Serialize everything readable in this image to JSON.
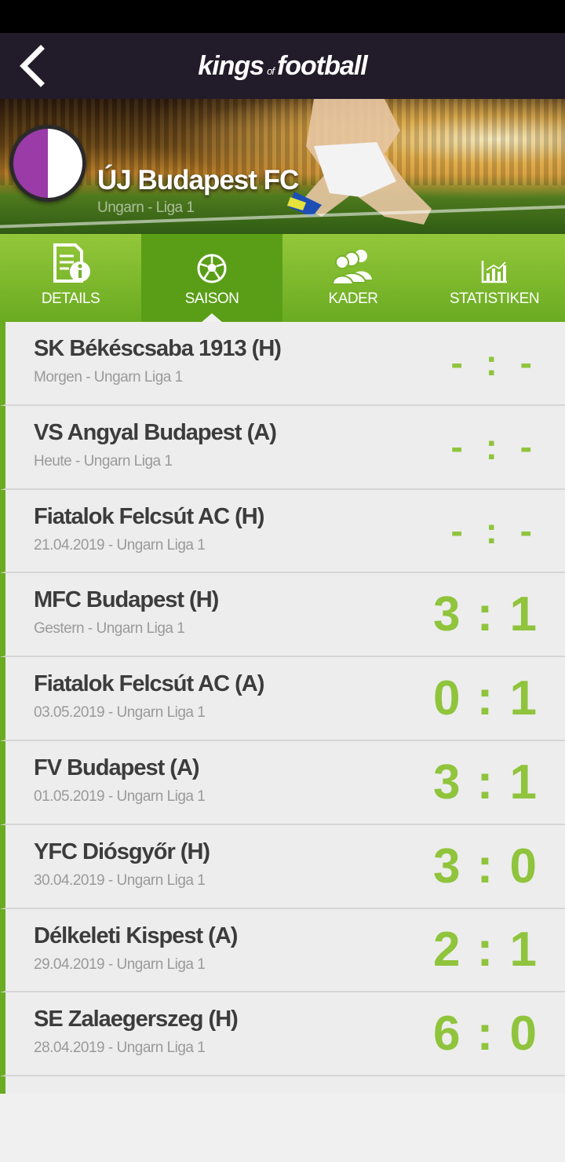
{
  "header": {
    "logo_kings": "kings",
    "logo_of": "of",
    "logo_football": "football"
  },
  "team": {
    "name": "ÚJ Budapest FC",
    "league": "Ungarn - Liga 1",
    "crest_colors": [
      "#9a3ba8",
      "#ffffff"
    ]
  },
  "tabs": [
    {
      "label": "DETAILS",
      "icon": "document-info-icon",
      "active": false
    },
    {
      "label": "SAISON",
      "icon": "soccer-ball-icon",
      "active": true
    },
    {
      "label": "KADER",
      "icon": "people-group-icon",
      "active": false
    },
    {
      "label": "STATISTIKEN",
      "icon": "bar-chart-icon",
      "active": false
    }
  ],
  "matches": [
    {
      "title": "SK Békéscsaba 1913 (H)",
      "sub": "Morgen - Ungarn Liga 1",
      "score": "- : -"
    },
    {
      "title": "VS Angyal Budapest (A)",
      "sub": "Heute - Ungarn Liga 1",
      "score": "- : -"
    },
    {
      "title": "Fiatalok Felcsút AC (H)",
      "sub": "21.04.2019 - Ungarn Liga 1",
      "score": "- : -"
    },
    {
      "title": "MFC Budapest (H)",
      "sub": "Gestern - Ungarn Liga 1",
      "score": "3 : 1"
    },
    {
      "title": "Fiatalok Felcsút AC (A)",
      "sub": "03.05.2019 - Ungarn Liga 1",
      "score": "0 : 1"
    },
    {
      "title": "FV Budapest (A)",
      "sub": "01.05.2019 - Ungarn Liga 1",
      "score": "3 : 1"
    },
    {
      "title": "YFC Diósgyőr (H)",
      "sub": "30.04.2019 - Ungarn Liga 1",
      "score": "3 : 0"
    },
    {
      "title": "Délkeleti Kispest (A)",
      "sub": "29.04.2019 - Ungarn Liga 1",
      "score": "2 : 1"
    },
    {
      "title": "SE Zalaegerszeg (H)",
      "sub": "28.04.2019 - Ungarn Liga 1",
      "score": "6 : 0"
    }
  ],
  "colors": {
    "accent_green": "#6aab22",
    "score_green": "#8fc43c",
    "header_bg": "#221b29"
  }
}
